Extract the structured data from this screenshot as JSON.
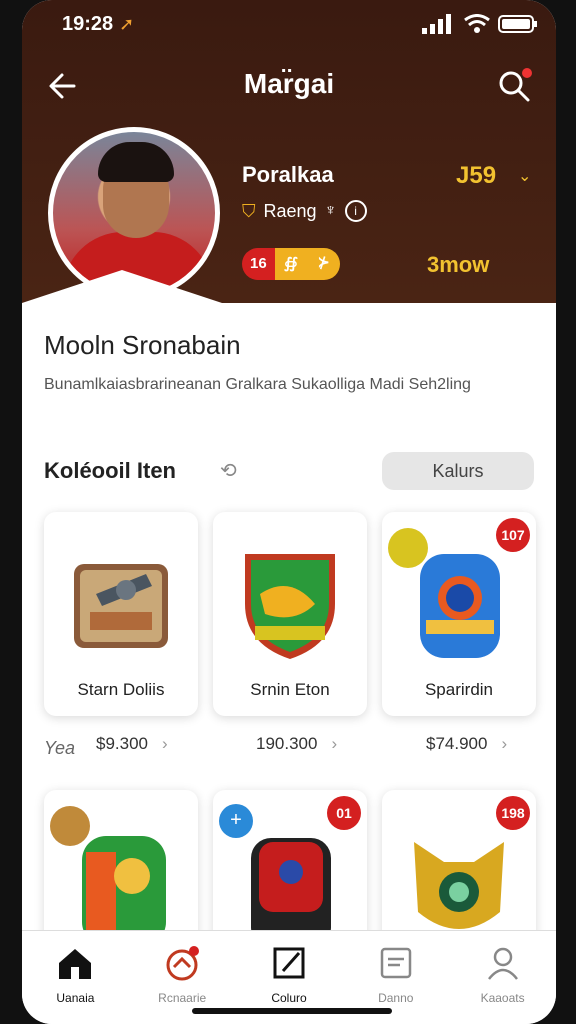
{
  "status_bar": {
    "time": "19:28",
    "location_arrow": "location-arrow-icon"
  },
  "header": {
    "title": "Mar̈gai",
    "back_icon": "back-arrow-icon",
    "search_icon": "search-icon"
  },
  "profile": {
    "name": "Poralkaa",
    "value": "J59",
    "role": "Raeng",
    "amount": "3mow",
    "badges": [
      "16",
      "∯",
      "⊁"
    ]
  },
  "content": {
    "title": "Mooln Sronabain",
    "description": "Bunamlkaiasbrarineanan Gralkara Sukaolliga Madi Seh2ling"
  },
  "section": {
    "title": "Koléooil Iten",
    "filter_label": "Kalurs"
  },
  "items": [
    {
      "label": "Starn Doliis",
      "price": "$9.300"
    },
    {
      "label": "Srnin Eton",
      "price": "190.300"
    },
    {
      "label": "Sparirdin",
      "price": "$74.900",
      "tag": "107"
    }
  ],
  "items_row2": [
    {
      "tag": ""
    },
    {
      "tag": "01"
    },
    {
      "tag": "198"
    }
  ],
  "price_prefix": "Yea",
  "tabs": [
    {
      "label": "Uanaia",
      "icon": "home-icon"
    },
    {
      "label": "Rcnaarie",
      "icon": "ball-icon"
    },
    {
      "label": "Coluro",
      "icon": "edit-icon"
    },
    {
      "label": "Danno",
      "icon": "document-icon"
    },
    {
      "label": "Kaaoats",
      "icon": "profile-icon"
    }
  ],
  "colors": {
    "header_bg": "#3a1a10",
    "accent_gold": "#f2c230",
    "red": "#d42020"
  }
}
